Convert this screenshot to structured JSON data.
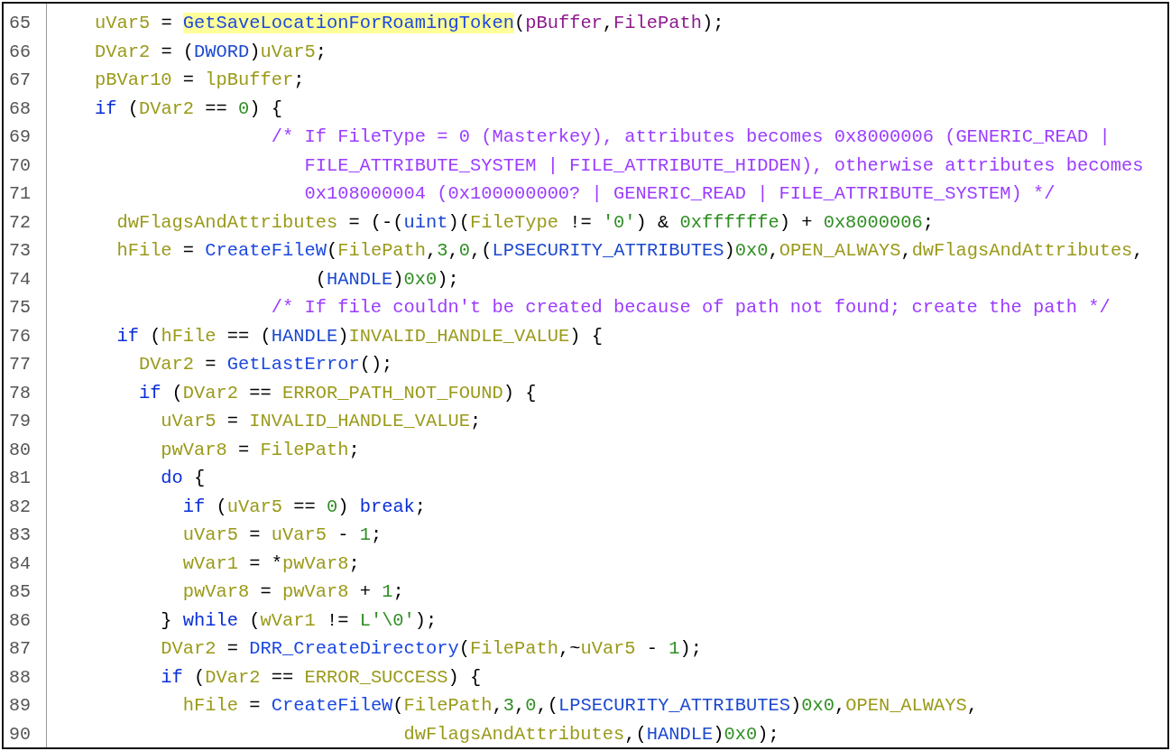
{
  "lines": [
    {
      "number": "65",
      "tokens": [
        {
          "kind": "var",
          "text": "    uVar5"
        },
        {
          "kind": "punct",
          "text": " = "
        },
        {
          "kind": "call-highlight",
          "text": "GetSaveLocationForRoamingToken"
        },
        {
          "kind": "punct",
          "text": "("
        },
        {
          "kind": "param",
          "text": "pBuffer"
        },
        {
          "kind": "punct",
          "text": ","
        },
        {
          "kind": "param",
          "text": "FilePath"
        },
        {
          "kind": "punct",
          "text": ");"
        }
      ]
    },
    {
      "number": "66",
      "tokens": [
        {
          "kind": "var",
          "text": "    DVar2"
        },
        {
          "kind": "punct",
          "text": " = ("
        },
        {
          "kind": "type",
          "text": "DWORD"
        },
        {
          "kind": "punct",
          "text": ")"
        },
        {
          "kind": "var",
          "text": "uVar5"
        },
        {
          "kind": "punct",
          "text": ";"
        }
      ]
    },
    {
      "number": "67",
      "tokens": [
        {
          "kind": "var",
          "text": "    pBVar10"
        },
        {
          "kind": "punct",
          "text": " = "
        },
        {
          "kind": "var",
          "text": "lpBuffer"
        },
        {
          "kind": "punct",
          "text": ";"
        }
      ]
    },
    {
      "number": "68",
      "tokens": [
        {
          "kind": "keyword",
          "text": "    if"
        },
        {
          "kind": "punct",
          "text": " ("
        },
        {
          "kind": "var",
          "text": "DVar2"
        },
        {
          "kind": "punct",
          "text": " == "
        },
        {
          "kind": "num",
          "text": "0"
        },
        {
          "kind": "punct",
          "text": ") {"
        }
      ]
    },
    {
      "number": "69",
      "tokens": [
        {
          "kind": "comment",
          "text": "                    /* If FileType = 0 (Masterkey), attributes becomes 0x8000006 (GENERIC_READ |"
        }
      ]
    },
    {
      "number": "70",
      "tokens": [
        {
          "kind": "comment",
          "text": "                       FILE_ATTRIBUTE_SYSTEM | FILE_ATTRIBUTE_HIDDEN), otherwise attributes becomes"
        }
      ]
    },
    {
      "number": "71",
      "tokens": [
        {
          "kind": "comment",
          "text": "                       0x108000004 (0x100000000? | GENERIC_READ | FILE_ATTRIBUTE_SYSTEM) */"
        }
      ]
    },
    {
      "number": "72",
      "tokens": [
        {
          "kind": "var",
          "text": "      dwFlagsAndAttributes"
        },
        {
          "kind": "punct",
          "text": " = (-("
        },
        {
          "kind": "type",
          "text": "uint"
        },
        {
          "kind": "punct",
          "text": ")("
        },
        {
          "kind": "var",
          "text": "FileType"
        },
        {
          "kind": "punct",
          "text": " != "
        },
        {
          "kind": "num",
          "text": "'0'"
        },
        {
          "kind": "punct",
          "text": ") & "
        },
        {
          "kind": "num",
          "text": "0xffffffe"
        },
        {
          "kind": "punct",
          "text": ") + "
        },
        {
          "kind": "num",
          "text": "0x8000006"
        },
        {
          "kind": "punct",
          "text": ";"
        }
      ]
    },
    {
      "number": "73",
      "tokens": [
        {
          "kind": "var",
          "text": "      hFile"
        },
        {
          "kind": "punct",
          "text": " = "
        },
        {
          "kind": "func",
          "text": "CreateFileW"
        },
        {
          "kind": "punct",
          "text": "("
        },
        {
          "kind": "var",
          "text": "FilePath"
        },
        {
          "kind": "punct",
          "text": ","
        },
        {
          "kind": "num",
          "text": "3"
        },
        {
          "kind": "punct",
          "text": ","
        },
        {
          "kind": "num",
          "text": "0"
        },
        {
          "kind": "punct",
          "text": ",("
        },
        {
          "kind": "type",
          "text": "LPSECURITY_ATTRIBUTES"
        },
        {
          "kind": "punct",
          "text": ")"
        },
        {
          "kind": "num",
          "text": "0x0"
        },
        {
          "kind": "punct",
          "text": ","
        },
        {
          "kind": "var",
          "text": "OPEN_ALWAYS"
        },
        {
          "kind": "punct",
          "text": ","
        },
        {
          "kind": "var",
          "text": "dwFlagsAndAttributes"
        },
        {
          "kind": "punct",
          "text": ","
        }
      ]
    },
    {
      "number": "74",
      "tokens": [
        {
          "kind": "punct",
          "text": "                        ("
        },
        {
          "kind": "type",
          "text": "HANDLE"
        },
        {
          "kind": "punct",
          "text": ")"
        },
        {
          "kind": "num",
          "text": "0x0"
        },
        {
          "kind": "punct",
          "text": ");"
        }
      ]
    },
    {
      "number": "75",
      "tokens": [
        {
          "kind": "comment",
          "text": "                    /* If file couldn't be created because of path not found; create the path */"
        }
      ]
    },
    {
      "number": "76",
      "tokens": [
        {
          "kind": "keyword",
          "text": "      if"
        },
        {
          "kind": "punct",
          "text": " ("
        },
        {
          "kind": "var",
          "text": "hFile"
        },
        {
          "kind": "punct",
          "text": " == ("
        },
        {
          "kind": "type",
          "text": "HANDLE"
        },
        {
          "kind": "punct",
          "text": ")"
        },
        {
          "kind": "var",
          "text": "INVALID_HANDLE_VALUE"
        },
        {
          "kind": "punct",
          "text": ") {"
        }
      ]
    },
    {
      "number": "77",
      "tokens": [
        {
          "kind": "var",
          "text": "        DVar2"
        },
        {
          "kind": "punct",
          "text": " = "
        },
        {
          "kind": "func",
          "text": "GetLastError"
        },
        {
          "kind": "punct",
          "text": "();"
        }
      ]
    },
    {
      "number": "78",
      "tokens": [
        {
          "kind": "keyword",
          "text": "        if"
        },
        {
          "kind": "punct",
          "text": " ("
        },
        {
          "kind": "var",
          "text": "DVar2"
        },
        {
          "kind": "punct",
          "text": " == "
        },
        {
          "kind": "var",
          "text": "ERROR_PATH_NOT_FOUND"
        },
        {
          "kind": "punct",
          "text": ") {"
        }
      ]
    },
    {
      "number": "79",
      "tokens": [
        {
          "kind": "var",
          "text": "          uVar5"
        },
        {
          "kind": "punct",
          "text": " = "
        },
        {
          "kind": "var",
          "text": "INVALID_HANDLE_VALUE"
        },
        {
          "kind": "punct",
          "text": ";"
        }
      ]
    },
    {
      "number": "80",
      "tokens": [
        {
          "kind": "var",
          "text": "          pwVar8"
        },
        {
          "kind": "punct",
          "text": " = "
        },
        {
          "kind": "var",
          "text": "FilePath"
        },
        {
          "kind": "punct",
          "text": ";"
        }
      ]
    },
    {
      "number": "81",
      "tokens": [
        {
          "kind": "keyword",
          "text": "          do"
        },
        {
          "kind": "punct",
          "text": " {"
        }
      ]
    },
    {
      "number": "82",
      "tokens": [
        {
          "kind": "keyword",
          "text": "            if"
        },
        {
          "kind": "punct",
          "text": " ("
        },
        {
          "kind": "var",
          "text": "uVar5"
        },
        {
          "kind": "punct",
          "text": " == "
        },
        {
          "kind": "num",
          "text": "0"
        },
        {
          "kind": "punct",
          "text": ") "
        },
        {
          "kind": "keyword",
          "text": "break"
        },
        {
          "kind": "punct",
          "text": ";"
        }
      ]
    },
    {
      "number": "83",
      "tokens": [
        {
          "kind": "var",
          "text": "            uVar5"
        },
        {
          "kind": "punct",
          "text": " = "
        },
        {
          "kind": "var",
          "text": "uVar5"
        },
        {
          "kind": "punct",
          "text": " - "
        },
        {
          "kind": "num",
          "text": "1"
        },
        {
          "kind": "punct",
          "text": ";"
        }
      ]
    },
    {
      "number": "84",
      "tokens": [
        {
          "kind": "var",
          "text": "            wVar1"
        },
        {
          "kind": "punct",
          "text": " = *"
        },
        {
          "kind": "var",
          "text": "pwVar8"
        },
        {
          "kind": "punct",
          "text": ";"
        }
      ]
    },
    {
      "number": "85",
      "tokens": [
        {
          "kind": "var",
          "text": "            pwVar8"
        },
        {
          "kind": "punct",
          "text": " = "
        },
        {
          "kind": "var",
          "text": "pwVar8"
        },
        {
          "kind": "punct",
          "text": " + "
        },
        {
          "kind": "num",
          "text": "1"
        },
        {
          "kind": "punct",
          "text": ";"
        }
      ]
    },
    {
      "number": "86",
      "tokens": [
        {
          "kind": "punct",
          "text": "          } "
        },
        {
          "kind": "keyword",
          "text": "while"
        },
        {
          "kind": "punct",
          "text": " ("
        },
        {
          "kind": "var",
          "text": "wVar1"
        },
        {
          "kind": "punct",
          "text": " != "
        },
        {
          "kind": "num",
          "text": "L'\\0'"
        },
        {
          "kind": "punct",
          "text": ");"
        }
      ]
    },
    {
      "number": "87",
      "tokens": [
        {
          "kind": "var",
          "text": "          DVar2"
        },
        {
          "kind": "punct",
          "text": " = "
        },
        {
          "kind": "func",
          "text": "DRR_CreateDirectory"
        },
        {
          "kind": "punct",
          "text": "("
        },
        {
          "kind": "var",
          "text": "FilePath"
        },
        {
          "kind": "punct",
          "text": ",~"
        },
        {
          "kind": "var",
          "text": "uVar5"
        },
        {
          "kind": "punct",
          "text": " - "
        },
        {
          "kind": "num",
          "text": "1"
        },
        {
          "kind": "punct",
          "text": ");"
        }
      ]
    },
    {
      "number": "88",
      "tokens": [
        {
          "kind": "keyword",
          "text": "          if"
        },
        {
          "kind": "punct",
          "text": " ("
        },
        {
          "kind": "var",
          "text": "DVar2"
        },
        {
          "kind": "punct",
          "text": " == "
        },
        {
          "kind": "var",
          "text": "ERROR_SUCCESS"
        },
        {
          "kind": "punct",
          "text": ") {"
        }
      ]
    },
    {
      "number": "89",
      "tokens": [
        {
          "kind": "var",
          "text": "            hFile"
        },
        {
          "kind": "punct",
          "text": " = "
        },
        {
          "kind": "func",
          "text": "CreateFileW"
        },
        {
          "kind": "punct",
          "text": "("
        },
        {
          "kind": "var",
          "text": "FilePath"
        },
        {
          "kind": "punct",
          "text": ","
        },
        {
          "kind": "num",
          "text": "3"
        },
        {
          "kind": "punct",
          "text": ","
        },
        {
          "kind": "num",
          "text": "0"
        },
        {
          "kind": "punct",
          "text": ",("
        },
        {
          "kind": "type",
          "text": "LPSECURITY_ATTRIBUTES"
        },
        {
          "kind": "punct",
          "text": ")"
        },
        {
          "kind": "num",
          "text": "0x0"
        },
        {
          "kind": "punct",
          "text": ","
        },
        {
          "kind": "var",
          "text": "OPEN_ALWAYS"
        },
        {
          "kind": "punct",
          "text": ","
        }
      ]
    },
    {
      "number": "90",
      "tokens": [
        {
          "kind": "var",
          "text": "                                dwFlagsAndAttributes"
        },
        {
          "kind": "punct",
          "text": ",("
        },
        {
          "kind": "type",
          "text": "HANDLE"
        },
        {
          "kind": "punct",
          "text": ")"
        },
        {
          "kind": "num",
          "text": "0x0"
        },
        {
          "kind": "punct",
          "text": ");"
        }
      ]
    }
  ]
}
